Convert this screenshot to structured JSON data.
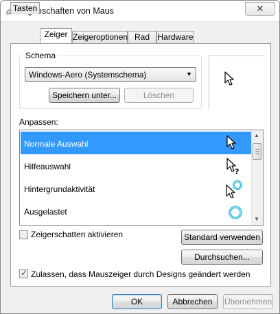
{
  "window": {
    "title": "Eigenschaften von Maus",
    "close_label": "✕"
  },
  "tabs": [
    {
      "label": "Tasten"
    },
    {
      "label": "Zeiger"
    },
    {
      "label": "Zeigeroptionen"
    },
    {
      "label": "Rad"
    },
    {
      "label": "Hardware"
    }
  ],
  "active_tab": "Zeiger",
  "schema": {
    "label": "Schema",
    "selected": "Windows-Aero (Systemschema)",
    "save_label": "Speichern unter...",
    "delete_label": "Löschen"
  },
  "customize": {
    "label": "Anpassen:",
    "items": [
      {
        "label": "Normale Auswahl",
        "icon": "arrow-cursor-icon",
        "selected": true
      },
      {
        "label": "Hilfeauswahl",
        "icon": "help-cursor-icon",
        "selected": false
      },
      {
        "label": "Hintergrundaktivität",
        "icon": "working-in-background-cursor-icon",
        "selected": false
      },
      {
        "label": "Ausgelastet",
        "icon": "busy-cursor-icon",
        "selected": false
      }
    ]
  },
  "options": {
    "shadow_label": "Zeigerschatten aktivieren",
    "shadow_checked": false,
    "use_default_label": "Standard verwenden",
    "browse_label": "Durchsuchen...",
    "themes_label": "Zulassen, dass Mauszeiger durch Designs geändert werden",
    "themes_checked": true
  },
  "footer": {
    "ok_label": "OK",
    "cancel_label": "Abbrechen",
    "apply_label": "Übernehmen"
  },
  "colors": {
    "selection": "#3399ff",
    "busy_ring": "#39b6d8"
  }
}
